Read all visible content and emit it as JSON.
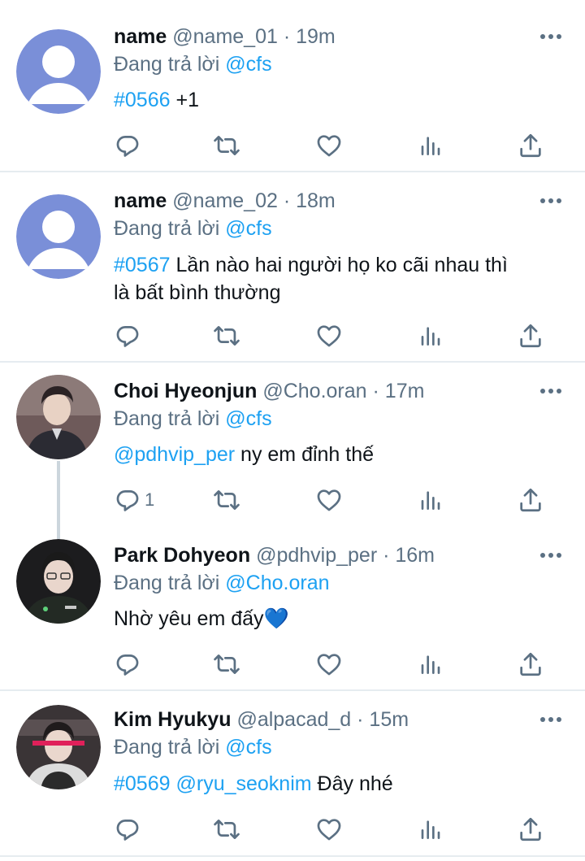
{
  "tweets": [
    {
      "name": "name",
      "handle": "@name_01",
      "time": "19m",
      "replying_prefix": "Đang trả lời",
      "replying_to": "@cfs",
      "tag": "#0566",
      "text": " +1",
      "reply_count": ""
    },
    {
      "name": "name",
      "handle": "@name_02",
      "time": "18m",
      "replying_prefix": "Đang trả lời",
      "replying_to": "@cfs",
      "tag": "#0567",
      "text_line1": " Lần nào hai người họ ko cãi nhau thì",
      "text_line2": "là bất bình thường",
      "reply_count": ""
    },
    {
      "name": "Choi Hyeonjun",
      "handle": "@Cho.oran",
      "time": "17m",
      "replying_prefix": "Đang trả lời",
      "replying_to": "@cfs",
      "mention": "@pdhvip_per",
      "text": " ny em đỉnh thế",
      "reply_count": "1"
    },
    {
      "name": "Park Dohyeon",
      "handle": "@pdhvip_per",
      "time": "16m",
      "replying_prefix": "Đang trả lời",
      "replying_to": "@Cho.oran",
      "text": "Nhờ yêu em đấy",
      "emoji": "💙",
      "reply_count": ""
    },
    {
      "name": "Kim Hyukyu",
      "handle": "@alpacad_d",
      "time": "15m",
      "replying_prefix": "Đang trả lời",
      "replying_to": "@cfs",
      "tag": "#0569",
      "mention": "@ryu_seoknim",
      "text": " Đây nhé",
      "reply_count": ""
    }
  ],
  "separator": " · ",
  "colors": {
    "link": "#1da1f2",
    "secondary_text": "#5b7083",
    "icon": "#5b7083",
    "divider": "#e6ecf0",
    "default_avatar": "#7a8fd8"
  },
  "icons": [
    "reply-icon",
    "retweet-icon",
    "like-icon",
    "analytics-icon",
    "share-icon",
    "more-icon"
  ]
}
